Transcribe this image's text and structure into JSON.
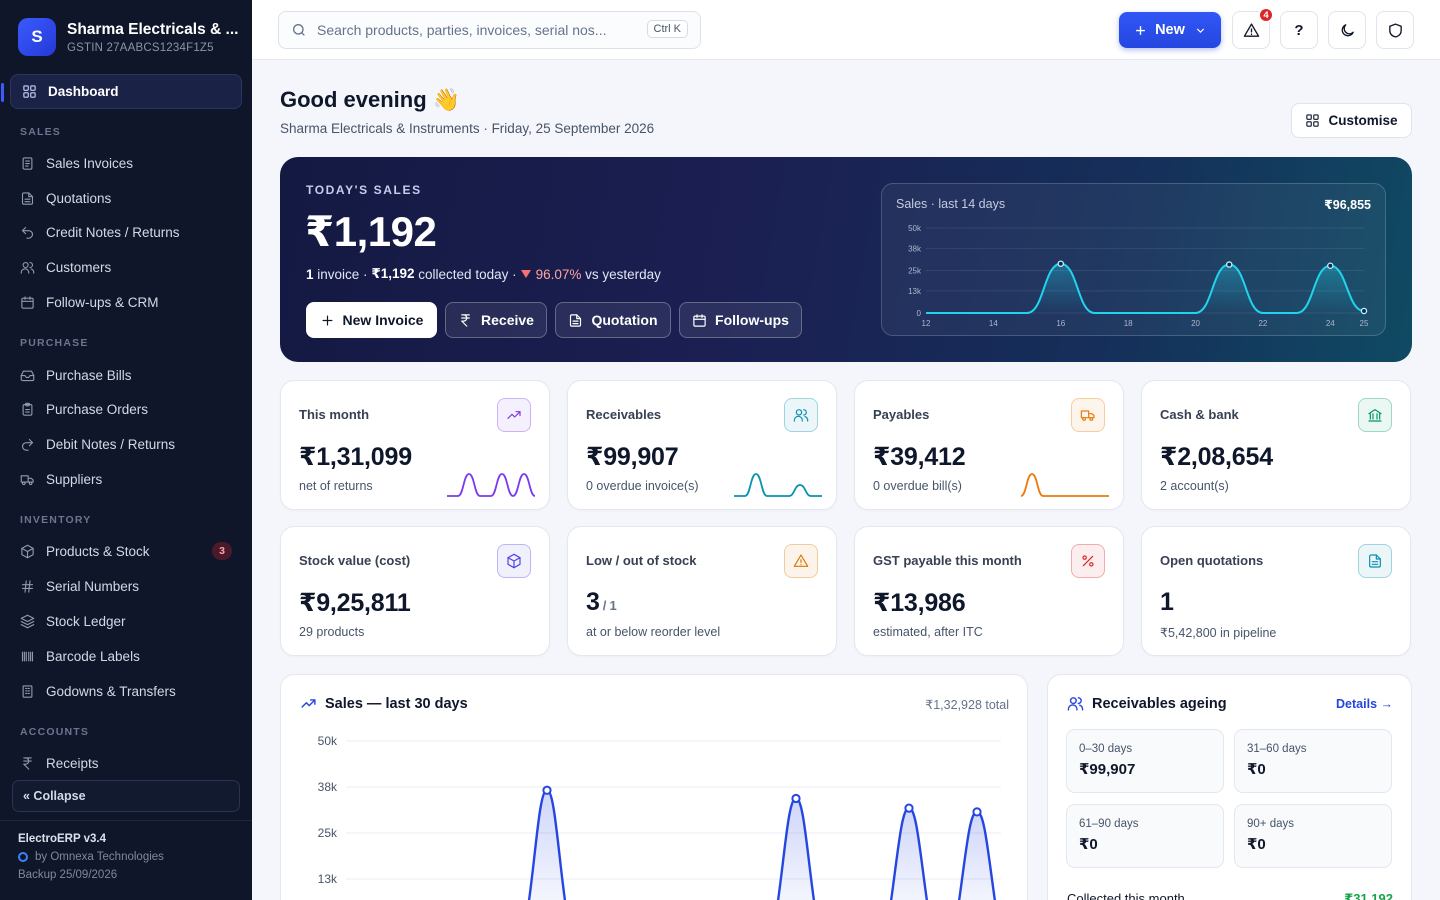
{
  "company": {
    "logo_letter": "S",
    "name": "Sharma Electricals & ...",
    "gstin": "GSTIN 27AABCS1234F1Z5"
  },
  "sidebar": {
    "active": {
      "label": "Dashboard",
      "icon": "dashboard-icon"
    },
    "sections": [
      {
        "title": "SALES",
        "items": [
          {
            "label": "Sales Invoices",
            "icon": "invoice-icon"
          },
          {
            "label": "Quotations",
            "icon": "document-icon"
          },
          {
            "label": "Credit Notes / Returns",
            "icon": "return-icon"
          },
          {
            "label": "Customers",
            "icon": "users-icon"
          },
          {
            "label": "Follow-ups & CRM",
            "icon": "calendar-icon"
          }
        ]
      },
      {
        "title": "PURCHASE",
        "items": [
          {
            "label": "Purchase Bills",
            "icon": "inbox-icon"
          },
          {
            "label": "Purchase Orders",
            "icon": "clipboard-icon"
          },
          {
            "label": "Debit Notes / Returns",
            "icon": "forward-icon"
          },
          {
            "label": "Suppliers",
            "icon": "truck-icon"
          }
        ]
      },
      {
        "title": "INVENTORY",
        "items": [
          {
            "label": "Products & Stock",
            "icon": "box-icon",
            "badge": "3"
          },
          {
            "label": "Serial Numbers",
            "icon": "hash-icon"
          },
          {
            "label": "Stock Ledger",
            "icon": "layers-icon"
          },
          {
            "label": "Barcode Labels",
            "icon": "barcode-icon"
          },
          {
            "label": "Godowns & Transfers",
            "icon": "building-icon"
          }
        ]
      },
      {
        "title": "ACCOUNTS",
        "items": [
          {
            "label": "Receipts",
            "icon": "rupee-icon"
          }
        ]
      }
    ],
    "collapse_label": "« Collapse",
    "footer": {
      "version": "ElectroERP v3.4",
      "by": "by Omnexa Technologies",
      "backup": "Backup 25/09/2026"
    }
  },
  "topbar": {
    "search_placeholder": "Search products, parties, invoices, serial nos...",
    "shortcut": "Ctrl K",
    "new_label": "New",
    "alert_count": "4",
    "help_label": "?"
  },
  "header": {
    "greeting": "Good evening 👋",
    "subtitle": "Sharma Electricals & Instruments · Friday, 25 September 2026",
    "customise_label": "Customise"
  },
  "hero": {
    "label": "TODAY'S SALES",
    "amount": "₹1,192",
    "invoice_count": "1",
    "invoice_word": "invoice ·",
    "collected_amount": "₹1,192",
    "collected_word": "collected today ·",
    "change": "96.07%",
    "change_suffix": "vs yesterday",
    "buttons": [
      "New Invoice",
      "Receive",
      "Quotation",
      "Follow-ups"
    ],
    "mini_chart": {
      "title": "Sales · last 14 days",
      "total": "₹96,855"
    }
  },
  "kpis": [
    {
      "label": "This month",
      "value": "₹1,31,099",
      "sub": "net of returns",
      "icon": "trending-up-icon",
      "accent": "#7c3aed"
    },
    {
      "label": "Receivables",
      "value": "₹99,907",
      "sub": "0 overdue invoice(s)",
      "icon": "users-icon",
      "accent": "#0891b2"
    },
    {
      "label": "Payables",
      "value": "₹39,412",
      "sub": "0 overdue bill(s)",
      "icon": "truck-icon",
      "accent": "#ea7a0c"
    },
    {
      "label": "Cash & bank",
      "value": "₹2,08,654",
      "sub": "2 account(s)",
      "icon": "bank-icon",
      "accent": "#059669"
    },
    {
      "label": "Stock value (cost)",
      "value": "₹9,25,811",
      "sub": "29 products",
      "icon": "box-icon",
      "accent": "#4f46e5"
    },
    {
      "label": "Low / out of stock",
      "value": "3",
      "value_suffix": "/ 1",
      "sub": "at or below reorder level",
      "icon": "warning-icon",
      "accent": "#d97706"
    },
    {
      "label": "GST payable this month",
      "value": "₹13,986",
      "sub": "estimated, after ITC",
      "icon": "percent-icon",
      "accent": "#dc2626"
    },
    {
      "label": "Open quotations",
      "value": "1",
      "sub": "₹5,42,800 in pipeline",
      "icon": "document-icon",
      "accent": "#0891b2"
    }
  ],
  "sales_panel": {
    "title": "Sales — last 30 days",
    "total": "₹1,32,928 total"
  },
  "ageing": {
    "title": "Receivables ageing",
    "details_label": "Details →",
    "buckets": [
      {
        "label": "0–30 days",
        "value": "₹99,907"
      },
      {
        "label": "31–60 days",
        "value": "₹0"
      },
      {
        "label": "61–90 days",
        "value": "₹0"
      },
      {
        "label": "90+ days",
        "value": "₹0"
      }
    ],
    "collected_label": "Collected this month",
    "collected_value": "₹31,192"
  },
  "chart_data": [
    {
      "type": "area",
      "title": "Sales · last 14 days",
      "x": [
        12,
        13,
        14,
        15,
        16,
        17,
        18,
        19,
        20,
        21,
        22,
        23,
        24,
        25
      ],
      "series": [
        {
          "values": [
            0,
            0,
            0,
            0,
            29000,
            0,
            0,
            0,
            0,
            28500,
            0,
            0,
            27800,
            1192
          ]
        }
      ],
      "ylim": [
        0,
        50000
      ],
      "yticks": [
        "0",
        "13k",
        "25k",
        "38k",
        "50k"
      ],
      "xticks": [
        "12",
        "14",
        "16",
        "18",
        "20",
        "22",
        "24",
        "25"
      ],
      "grid": true
    },
    {
      "type": "area",
      "title": "Sales — last 30 days",
      "ylim": [
        0,
        50000
      ],
      "yticks": [
        "13k",
        "25k",
        "38k",
        "50k"
      ],
      "peaks": [
        36800,
        34600,
        32000,
        31000
      ],
      "grid": true
    }
  ]
}
